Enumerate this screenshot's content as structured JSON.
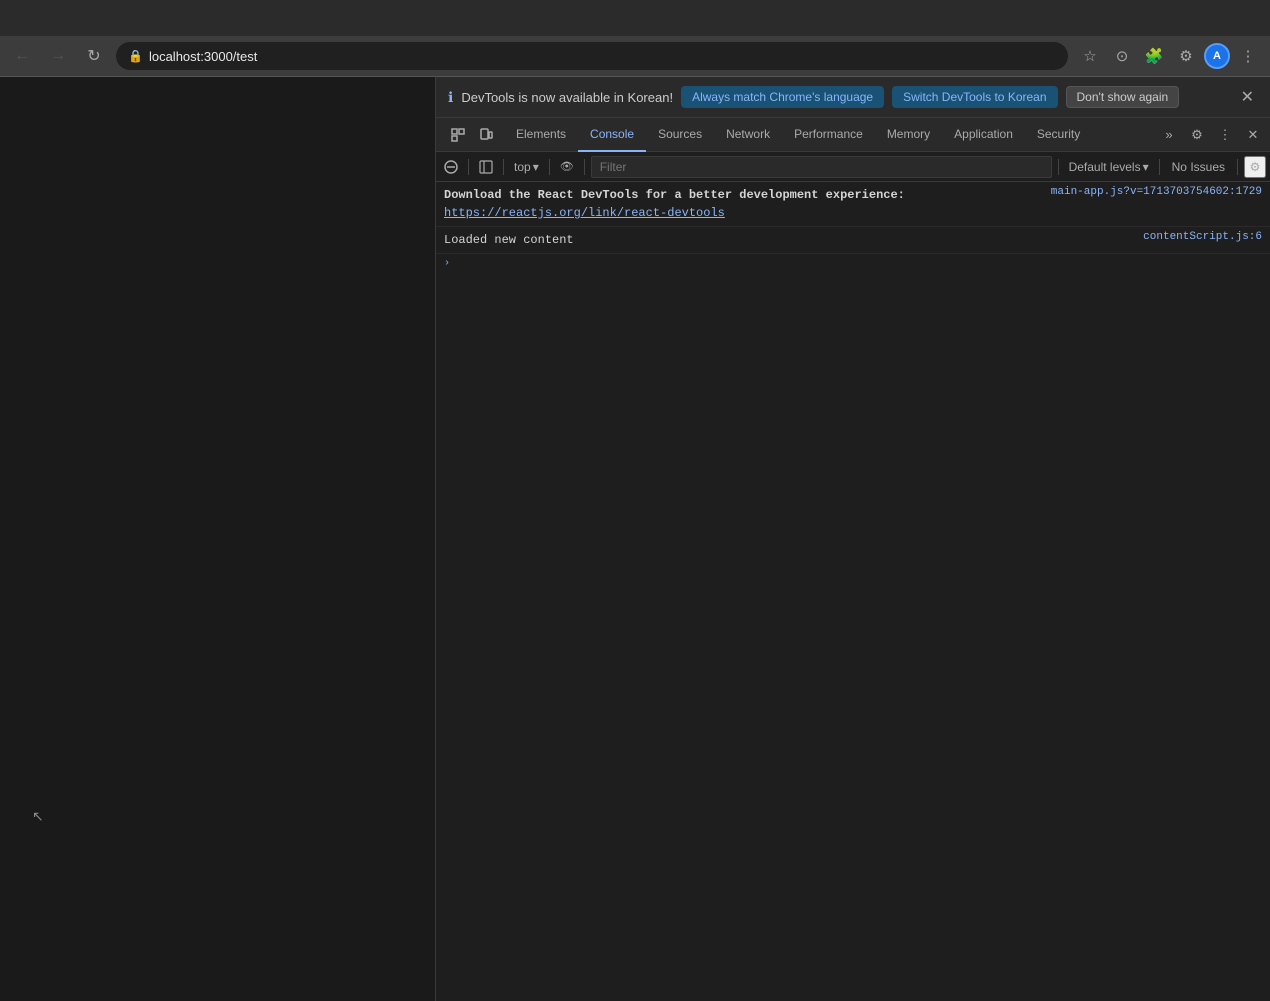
{
  "browser": {
    "url": "localhost:3000/test",
    "back_disabled": true,
    "forward_disabled": true
  },
  "devtools_notification": {
    "info_icon": "ℹ",
    "message": "DevTools is now available in Korean!",
    "btn_match_label": "Always match Chrome's language",
    "btn_switch_label": "Switch DevTools to Korean",
    "btn_dismiss_label": "Don't show again",
    "close_icon": "✕"
  },
  "devtools_tabs": {
    "items": [
      {
        "label": "Elements",
        "active": false
      },
      {
        "label": "Console",
        "active": true
      },
      {
        "label": "Sources",
        "active": false
      },
      {
        "label": "Network",
        "active": false
      },
      {
        "label": "Performance",
        "active": false
      },
      {
        "label": "Memory",
        "active": false
      },
      {
        "label": "Application",
        "active": false
      },
      {
        "label": "Security",
        "active": false
      }
    ],
    "overflow_icon": "»"
  },
  "console_toolbar": {
    "clear_icon": "🚫",
    "filter_placeholder": "Filter",
    "top_label": "top",
    "dropdown_icon": "▾",
    "eye_icon": "👁",
    "default_levels_label": "Default levels",
    "default_levels_icon": "▾",
    "no_issues_label": "No Issues",
    "settings_icon": "⚙"
  },
  "console_messages": [
    {
      "text_before": "Download the React DevTools for a better development experience: ",
      "link_text": "https://reactjs.org/link/react-devtools",
      "link_href": "#",
      "source": "main-app.js?v=1713703754602:1729",
      "bold": true
    },
    {
      "text_before": "Loaded new content",
      "link_text": "",
      "link_href": "",
      "source": "contentScript.js:6",
      "bold": false
    }
  ],
  "console_prompt": {
    "icon": "›"
  },
  "colors": {
    "active_tab_color": "#8ab4f8",
    "link_color": "#8ab4f8",
    "btn_match_bg": "#1a5276",
    "btn_switch_bg": "#1a5276",
    "btn_dismiss_bg": "#444"
  }
}
